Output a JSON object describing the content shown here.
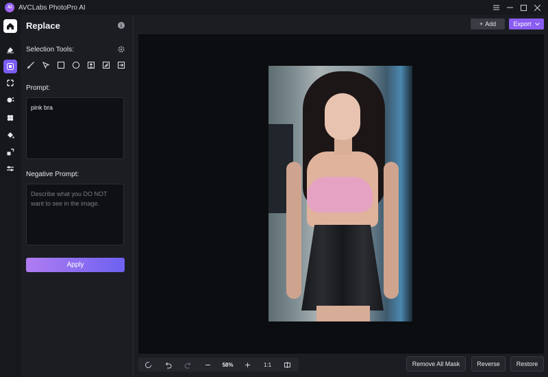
{
  "window": {
    "title": "AVCLabs PhotoPro AI",
    "logo_text": "AI",
    "controls": [
      "menu-icon",
      "minimize-icon",
      "maximize-icon",
      "close-icon"
    ]
  },
  "rail": {
    "items": [
      "home-icon",
      "eraser-icon",
      "replace-icon",
      "upscale-icon",
      "denoise-icon",
      "enhance-icon",
      "colorize-icon",
      "crop-icon",
      "adjust-icon"
    ],
    "active": "replace-icon"
  },
  "panel": {
    "title": "Replace",
    "selection_tools_label": "Selection Tools:",
    "tools": [
      "brush-icon",
      "lasso-icon",
      "rectangle-icon",
      "ellipse-icon",
      "portrait-select-icon",
      "auto-select-icon",
      "import-mask-icon"
    ],
    "prompt_label": "Prompt:",
    "prompt_value": "pink bra",
    "negative_label": "Negative Prompt:",
    "negative_placeholder": "Describe what you DO NOT want to see in the image.",
    "apply_label": "Apply"
  },
  "toolbar": {
    "add_label": "Add",
    "export_label": "Export"
  },
  "bottombar": {
    "zoom_value": "58%",
    "one_to_one": "1:1",
    "remove_all_mask": "Remove All Mask",
    "reverse": "Reverse",
    "restore": "Restore"
  },
  "colors": {
    "accent": "#8a5df2",
    "apply_gradient_start": "#b07cf2",
    "apply_gradient_end": "#6d61f0",
    "panel_bg": "#1b1d22",
    "canvas_bg": "#0c0d10"
  }
}
